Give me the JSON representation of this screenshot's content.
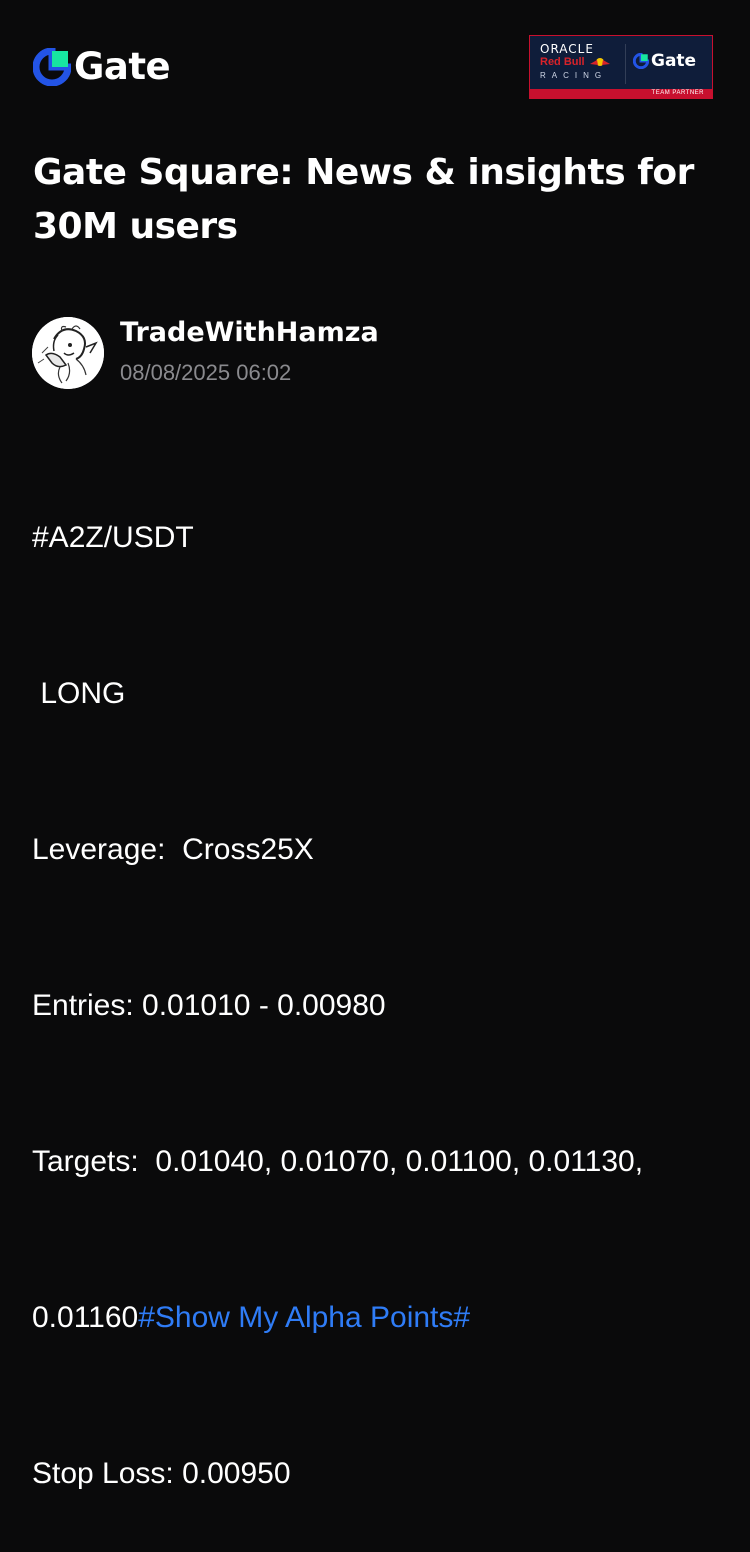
{
  "header": {
    "brand_name": "Gate",
    "brand_colors": {
      "blue": "#2354e6",
      "green": "#17e6a1"
    },
    "partner_badge": {
      "oracle_text": "ORACLE",
      "redbull_text": "Red Bull",
      "racing_text": "RACING",
      "gate_text": "Gate",
      "partner_text": "TEAM PARTNER",
      "accent_color": "#c8102e"
    }
  },
  "page": {
    "title": "Gate Square: News & insights for 30M users"
  },
  "post": {
    "author": {
      "name": "TradeWithHamza",
      "timestamp": "08/08/2025 06:02"
    },
    "lines": [
      "#A2Z/USDT",
      " LONG",
      "Leverage:  Cross25X",
      "Entries: 0.01010 - 0.00980",
      "Targets:  0.01040, 0.01070, 0.01100, 0.01130,"
    ],
    "line6_prefix": "0.01160",
    "hashtag": "#Show My Alpha Points#",
    "stop_loss": "Stop Loss: 0.00950",
    "hashtag_color": "#2f7cf6"
  }
}
